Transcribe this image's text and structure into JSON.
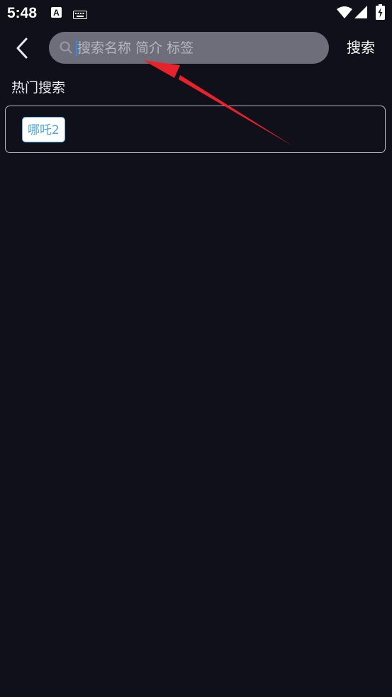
{
  "status_bar": {
    "time": "5:48",
    "notification_letter": "A",
    "icons": [
      "keyboard-icon",
      "wifi-icon",
      "signal-icon",
      "battery-icon"
    ]
  },
  "header": {
    "back_icon": "chevron-left-icon",
    "search": {
      "placeholder": "搜索名称 简介 标签",
      "value": ""
    },
    "search_button_label": "搜索"
  },
  "hot_search": {
    "title": "热门搜索",
    "tags": [
      "哪吒2"
    ]
  },
  "colors": {
    "background": "#10101b",
    "search_box": "#6e6e7a",
    "tag_text": "#4aa6dd",
    "annotation_arrow": "#e8222a"
  }
}
